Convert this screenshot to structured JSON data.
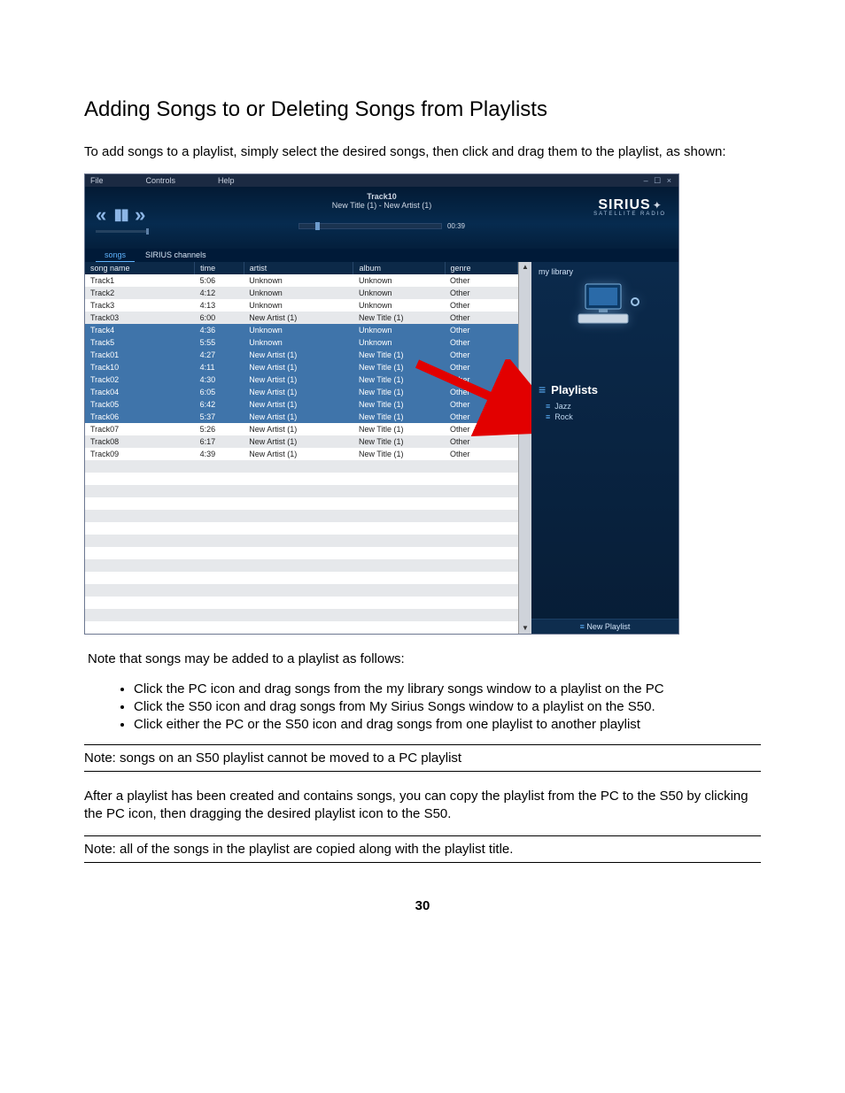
{
  "doc": {
    "heading": "Adding Songs to or Deleting Songs from Playlists",
    "intro": "To add songs to a playlist, simply select the desired songs, then click and drag them to the playlist, as shown:",
    "after_image": "Note that songs may be added to a playlist as follows:",
    "bullets": {
      "b1": "Click the PC icon and drag songs from the my library songs window to a playlist on the PC",
      "b2": "Click the S50 icon and drag songs from My Sirius Songs window to a playlist on the S50.",
      "b3": "Click either the PC or the S50 icon and drag songs from one playlist to another playlist"
    },
    "note1": "Note: songs on an S50 playlist cannot be moved to a PC playlist",
    "para2": "After a playlist has been created and contains songs, you can copy the playlist from the PC to the S50 by clicking the PC icon, then dragging the desired playlist icon to the S50.",
    "note2": "Note: all of the songs in the playlist are copied along with the playlist title.",
    "page_number": "30"
  },
  "app": {
    "menus": {
      "file": "File",
      "controls": "Controls",
      "help": "Help"
    },
    "window_icons": "–  ☐  ×",
    "now_playing": {
      "line1": "Track10",
      "line2": "New Title (1)  -  New Artist (1)"
    },
    "time": "00:39",
    "logo": {
      "name": "SIRIUS",
      "tag": "SATELLITE  RADIO"
    },
    "tabs": {
      "songs": "songs",
      "channels": "SIRIUS channels"
    },
    "columns": {
      "name": "song name",
      "time": "time",
      "artist": "artist",
      "album": "album",
      "genre": "genre"
    },
    "tracks": [
      {
        "name": "Track1",
        "time": "5:06",
        "artist": "Unknown",
        "album": "Unknown",
        "genre": "Other",
        "sel": false
      },
      {
        "name": "Track2",
        "time": "4:12",
        "artist": "Unknown",
        "album": "Unknown",
        "genre": "Other",
        "sel": false
      },
      {
        "name": "Track3",
        "time": "4:13",
        "artist": "Unknown",
        "album": "Unknown",
        "genre": "Other",
        "sel": false
      },
      {
        "name": "Track03",
        "time": "6:00",
        "artist": "New Artist (1)",
        "album": "New Title (1)",
        "genre": "Other",
        "sel": false
      },
      {
        "name": "Track4",
        "time": "4:36",
        "artist": "Unknown",
        "album": "Unknown",
        "genre": "Other",
        "sel": true
      },
      {
        "name": "Track5",
        "time": "5:55",
        "artist": "Unknown",
        "album": "Unknown",
        "genre": "Other",
        "sel": true
      },
      {
        "name": "Track01",
        "time": "4:27",
        "artist": "New Artist (1)",
        "album": "New Title (1)",
        "genre": "Other",
        "sel": true
      },
      {
        "name": "Track10",
        "time": "4:11",
        "artist": "New Artist (1)",
        "album": "New Title (1)",
        "genre": "Other",
        "sel": true
      },
      {
        "name": "Track02",
        "time": "4:30",
        "artist": "New Artist (1)",
        "album": "New Title (1)",
        "genre": "Other",
        "sel": true
      },
      {
        "name": "Track04",
        "time": "6:05",
        "artist": "New Artist (1)",
        "album": "New Title (1)",
        "genre": "Other",
        "sel": true
      },
      {
        "name": "Track05",
        "time": "6:42",
        "artist": "New Artist (1)",
        "album": "New Title (1)",
        "genre": "Other",
        "sel": true
      },
      {
        "name": "Track06",
        "time": "5:37",
        "artist": "New Artist (1)",
        "album": "New Title (1)",
        "genre": "Other",
        "sel": true
      },
      {
        "name": "Track07",
        "time": "5:26",
        "artist": "New Artist (1)",
        "album": "New Title (1)",
        "genre": "Other",
        "sel": false
      },
      {
        "name": "Track08",
        "time": "6:17",
        "artist": "New Artist (1)",
        "album": "New Title (1)",
        "genre": "Other",
        "sel": false
      },
      {
        "name": "Track09",
        "time": "4:39",
        "artist": "New Artist (1)",
        "album": "New Title (1)",
        "genre": "Other",
        "sel": false
      }
    ],
    "blank_rows": 14,
    "side": {
      "library": "my library",
      "playlists_header": "Playlists",
      "items": {
        "p1": "Jazz",
        "p2": "Rock"
      },
      "new_playlist": "New Playlist"
    }
  }
}
